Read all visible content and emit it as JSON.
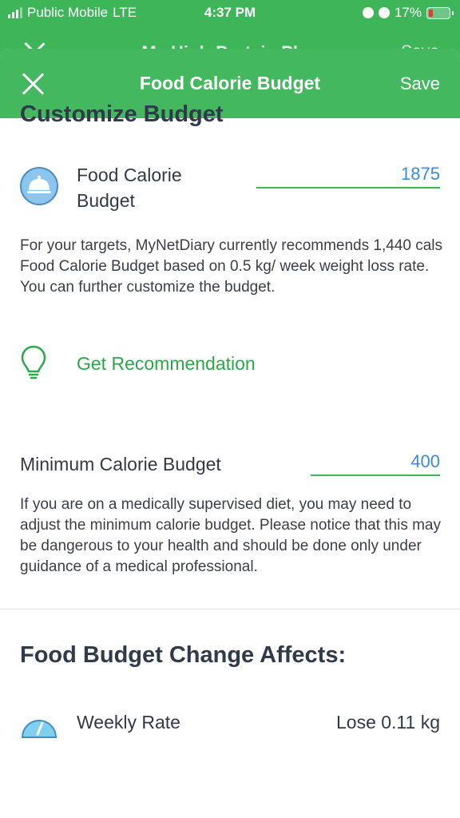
{
  "status_bar": {
    "carrier": "Public Mobile",
    "network": "LTE",
    "time": "4:37 PM",
    "battery": "17%",
    "battery_color": "#e23b30"
  },
  "background_nav": {
    "title": "My High-Protein Plan",
    "save_label": "Save"
  },
  "navbar": {
    "title": "Food Calorie Budget",
    "save_label": "Save",
    "close_icon": "close-icon",
    "color": "#43b85e"
  },
  "customize": {
    "title": "Customize Budget",
    "budget_label": "Food Calorie Budget",
    "budget_value": "1875",
    "budget_icon": "food-cloche-icon",
    "description": "For your targets, MyNetDiary currently recommends 1,440 cals Food Calorie Budget based on 0.5 kg/ week weight loss rate. You can further customize the budget.",
    "recommend_label": "Get Recommendation",
    "recommend_icon": "lightbulb-icon"
  },
  "minimum": {
    "label": "Minimum Calorie Budget",
    "value": "400",
    "description": "If you are on a medically supervised diet, you may need to adjust the minimum calorie budget. Please notice that this may be dangerous to your health and should be done only under guidance of a medical professional."
  },
  "affects": {
    "title": "Food Budget Change Affects:",
    "weekly_label": "Weekly Rate",
    "weekly_value": "Lose 0.11 kg",
    "weekly_icon": "gauge-icon"
  },
  "colors": {
    "accent_green": "#3fb55a",
    "value_blue": "#3d8bd8"
  }
}
